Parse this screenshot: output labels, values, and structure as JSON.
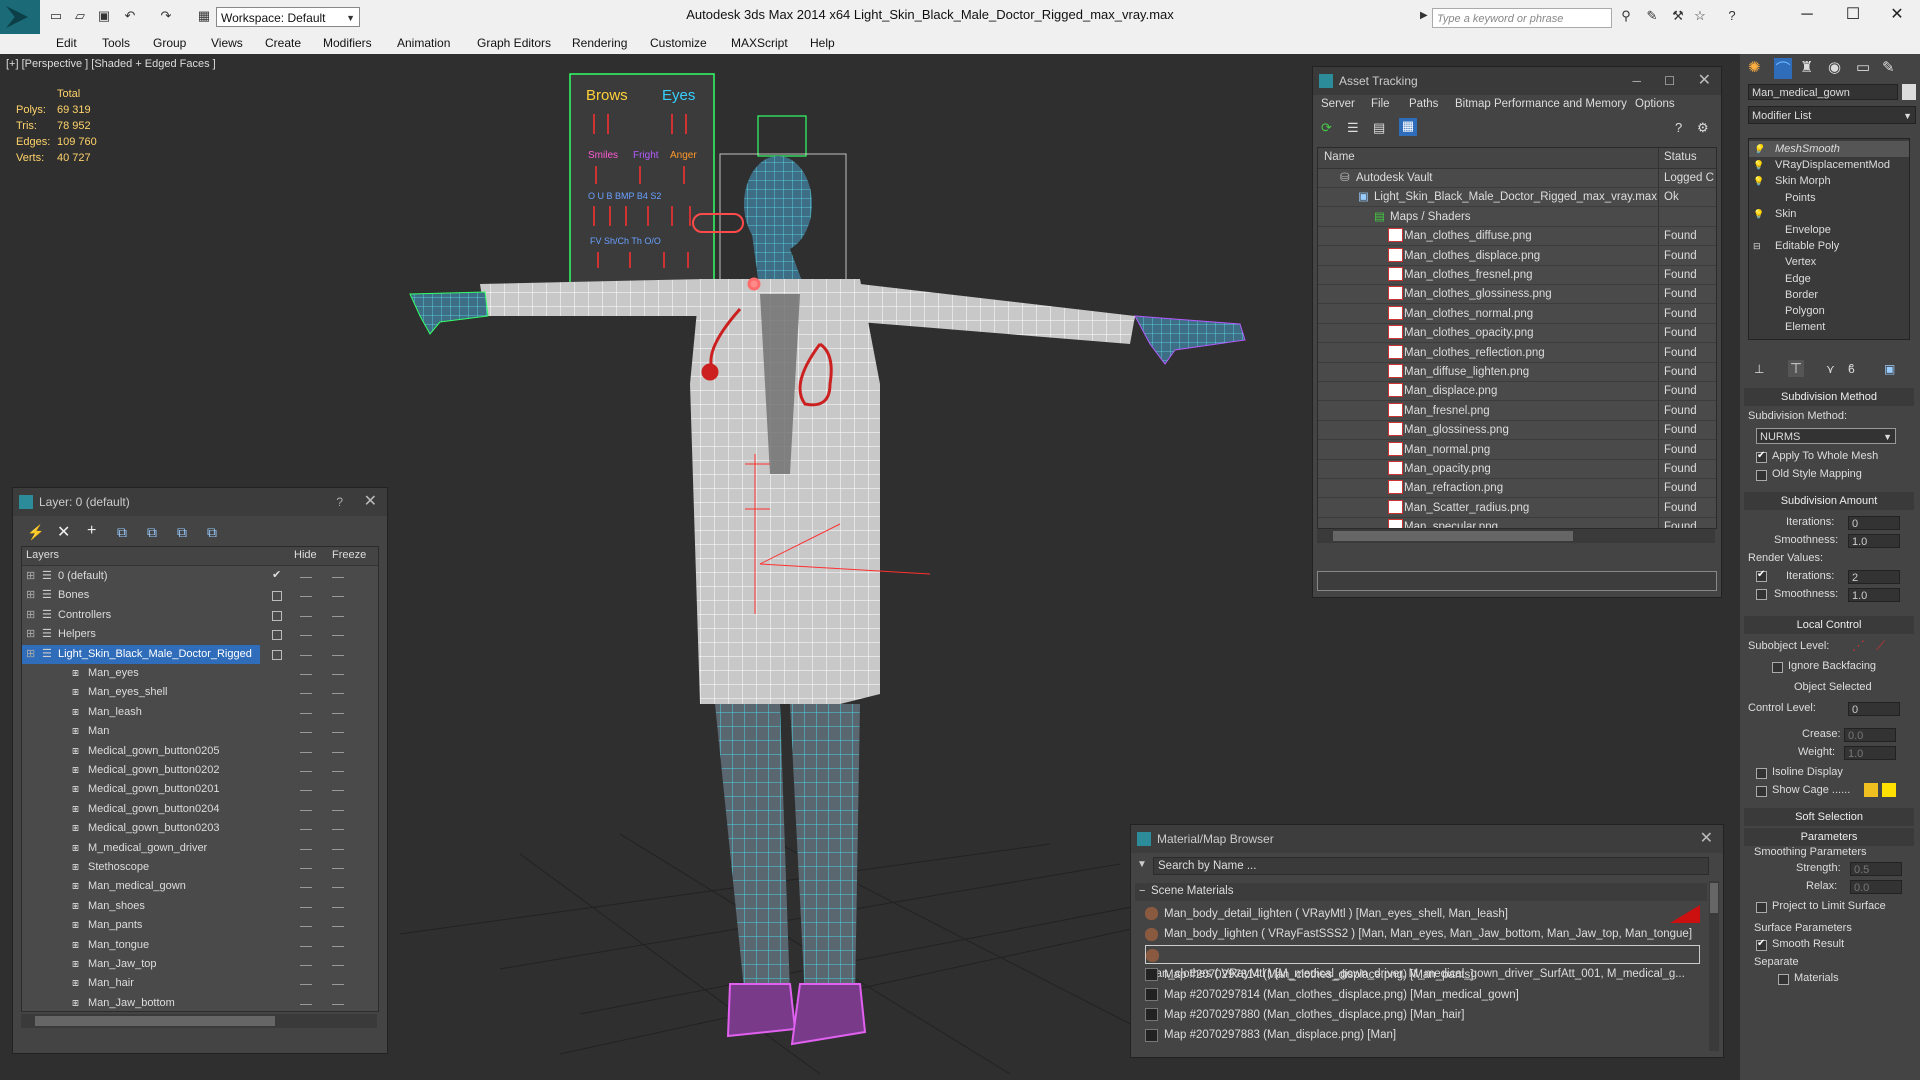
{
  "app": {
    "title": "Autodesk 3ds Max  2014 x64      Light_Skin_Black_Male_Doctor_Rigged_max_vray.max",
    "workspace": "Workspace: Default",
    "search_placeholder": "Type a keyword or phrase"
  },
  "menu": [
    "Edit",
    "Tools",
    "Group",
    "Views",
    "Create",
    "Modifiers",
    "Animation",
    "Graph Editors",
    "Rendering",
    "Customize",
    "MAXScript",
    "Help"
  ],
  "viewport": {
    "label": "[+] [Perspective ] [Shaded + Edged Faces ]",
    "stats_header": "Total",
    "stats": [
      {
        "label": "Polys:",
        "value": "69 319"
      },
      {
        "label": "Tris:",
        "value": "78 952"
      },
      {
        "label": "Edges:",
        "value": "109 760"
      },
      {
        "label": "Verts:",
        "value": "40 727"
      }
    ],
    "face_ctrl": {
      "brows": "Brows",
      "eyes": "Eyes",
      "smiles": "Smiles",
      "fright": "Fright",
      "anger": "Anger",
      "row3": "O  U  B  BMP  B4 S2",
      "row4": "FV  Sh/Ch  Th  O/O"
    }
  },
  "layer_panel": {
    "title": "Layer: 0 (default)",
    "help": "?",
    "col_layers": "Layers",
    "col_hide": "Hide",
    "col_freeze": "Freeze",
    "rows": [
      {
        "name": "0 (default)",
        "level": 0,
        "group": true,
        "checked": true
      },
      {
        "name": "Bones",
        "level": 0,
        "group": true
      },
      {
        "name": "Controllers",
        "level": 0,
        "group": true
      },
      {
        "name": "Helpers",
        "level": 0,
        "group": true
      },
      {
        "name": "Light_Skin_Black_Male_Doctor_Rigged",
        "level": 0,
        "group": true,
        "selected": true
      },
      {
        "name": "Man_eyes",
        "level": 1
      },
      {
        "name": "Man_eyes_shell",
        "level": 1
      },
      {
        "name": "Man_leash",
        "level": 1
      },
      {
        "name": "Man",
        "level": 1
      },
      {
        "name": "Medical_gown_button0205",
        "level": 1
      },
      {
        "name": "Medical_gown_button0202",
        "level": 1
      },
      {
        "name": "Medical_gown_button0201",
        "level": 1
      },
      {
        "name": "Medical_gown_button0204",
        "level": 1
      },
      {
        "name": "Medical_gown_button0203",
        "level": 1
      },
      {
        "name": "M_medical_gown_driver",
        "level": 1
      },
      {
        "name": "Stethoscope",
        "level": 1
      },
      {
        "name": "Man_medical_gown",
        "level": 1
      },
      {
        "name": "Man_shoes",
        "level": 1
      },
      {
        "name": "Man_pants",
        "level": 1
      },
      {
        "name": "Man_tongue",
        "level": 1
      },
      {
        "name": "Man_Jaw_top",
        "level": 1
      },
      {
        "name": "Man_hair",
        "level": 1
      },
      {
        "name": "Man_Jaw_bottom",
        "level": 1
      }
    ]
  },
  "asset_panel": {
    "title": "Asset Tracking",
    "menu": [
      "Server",
      "File",
      "Paths",
      "Bitmap Performance and Memory",
      "Options"
    ],
    "col_name": "Name",
    "col_status": "Status",
    "rows": [
      {
        "name": "Autodesk Vault",
        "status": "Logged C",
        "indent": 0
      },
      {
        "name": "Light_Skin_Black_Male_Doctor_Rigged_max_vray.max",
        "status": "Ok",
        "indent": 1
      },
      {
        "name": "Maps / Shaders",
        "status": "",
        "indent": 2
      },
      {
        "name": "Man_clothes_diffuse.png",
        "status": "Found",
        "indent": 3
      },
      {
        "name": "Man_clothes_displace.png",
        "status": "Found",
        "indent": 3
      },
      {
        "name": "Man_clothes_fresnel.png",
        "status": "Found",
        "indent": 3
      },
      {
        "name": "Man_clothes_glossiness.png",
        "status": "Found",
        "indent": 3
      },
      {
        "name": "Man_clothes_normal.png",
        "status": "Found",
        "indent": 3
      },
      {
        "name": "Man_clothes_opacity.png",
        "status": "Found",
        "indent": 3
      },
      {
        "name": "Man_clothes_reflection.png",
        "status": "Found",
        "indent": 3
      },
      {
        "name": "Man_diffuse_lighten.png",
        "status": "Found",
        "indent": 3
      },
      {
        "name": "Man_displace.png",
        "status": "Found",
        "indent": 3
      },
      {
        "name": "Man_fresnel.png",
        "status": "Found",
        "indent": 3
      },
      {
        "name": "Man_glossiness.png",
        "status": "Found",
        "indent": 3
      },
      {
        "name": "Man_normal.png",
        "status": "Found",
        "indent": 3
      },
      {
        "name": "Man_opacity.png",
        "status": "Found",
        "indent": 3
      },
      {
        "name": "Man_refraction.png",
        "status": "Found",
        "indent": 3
      },
      {
        "name": "Man_Scatter_radius.png",
        "status": "Found",
        "indent": 3
      },
      {
        "name": "Man_specular.png",
        "status": "Found",
        "indent": 3
      }
    ]
  },
  "material_browser": {
    "title": "Material/Map Browser",
    "search_placeholder": "Search by Name ...",
    "section": "Scene Materials",
    "rows": [
      {
        "text": "Man_body_detail_lighten  ( VRayMtl ) [Man_eyes_shell, Man_leash]",
        "type": "mtl"
      },
      {
        "text": "Man_body_lighten  ( VRayFastSSS2 ) [Man, Man_eyes, Man_Jaw_bottom, Man_Jaw_top, Man_tongue]",
        "type": "mtl"
      },
      {
        "text": "Man_clothes  ( VRayMtl ) [M_medical_gown_driver, M_medical_gown_driver_SurfAtt_001, M_medical_g...",
        "type": "mtl"
      },
      {
        "text": "Map #2070297814 (Man_clothes_displace.png)  [Man_pants]",
        "type": "map"
      },
      {
        "text": "Map #2070297814 (Man_clothes_displace.png)  [Man_medical_gown]",
        "type": "map"
      },
      {
        "text": "Map #2070297880 (Man_clothes_displace.png)  [Man_hair]",
        "type": "map"
      },
      {
        "text": "Map #2070297883 (Man_displace.png)  [Man]",
        "type": "map"
      }
    ]
  },
  "command_panel": {
    "object_name": "Man_medical_gown",
    "modifier_list": "Modifier List",
    "stack": [
      {
        "name": "MeshSmooth",
        "italic": true
      },
      {
        "name": "VRayDisplacementMod"
      },
      {
        "name": "Skin Morph"
      },
      {
        "name": "Points",
        "sub": true
      },
      {
        "name": "Skin"
      },
      {
        "name": "Envelope",
        "sub": true
      },
      {
        "name": "Editable Poly"
      },
      {
        "name": "Vertex",
        "sub": true
      },
      {
        "name": "Edge",
        "sub": true
      },
      {
        "name": "Border",
        "sub": true
      },
      {
        "name": "Polygon",
        "sub": true
      },
      {
        "name": "Element",
        "sub": true
      }
    ],
    "subdiv_method_header": "Subdivision Method",
    "subdiv_method_label": "Subdivision Method:",
    "subdiv_method_value": "NURMS",
    "apply_whole_mesh": "Apply To Whole Mesh",
    "old_style_mapping": "Old Style Mapping",
    "subdiv_amount_header": "Subdivision Amount",
    "iterations_label": "Iterations:",
    "iterations_value": "0",
    "smoothness_label": "Smoothness:",
    "smoothness_value": "1.0",
    "render_values": "Render Values:",
    "r_iterations_label": "Iterations:",
    "r_iterations_value": "2",
    "r_smoothness_label": "Smoothness:",
    "r_smoothness_value": "1.0",
    "local_control_header": "Local Control",
    "subobject_level": "Subobject Level:",
    "ignore_backfacing": "Ignore Backfacing",
    "object_selected": "Object Selected",
    "control_level_label": "Control Level:",
    "control_level_value": "0",
    "crease_label": "Crease:",
    "crease_value": "0.0",
    "weight_label": "Weight:",
    "weight_value": "1.0",
    "isoline_display": "Isoline Display",
    "show_cage": "Show Cage ......",
    "soft_selection_header": "Soft Selection",
    "parameters_header": "Parameters",
    "smoothing_params": "Smoothing Parameters",
    "strength_label": "Strength:",
    "strength_value": "0.5",
    "relax_label": "Relax:",
    "relax_value": "0.0",
    "project_limit": "Project to Limit Surface",
    "surface_params": "Surface Parameters",
    "smooth_result": "Smooth Result",
    "separate": "Separate",
    "materials": "Materials"
  },
  "colors": {
    "accent": "#2f6cba",
    "wire_white": "#ffffff",
    "wire_cyan": "#3fd0e0",
    "shoes": "#e060f0",
    "rig_green": "#33ff66",
    "rig_red": "#ff2a2a"
  }
}
